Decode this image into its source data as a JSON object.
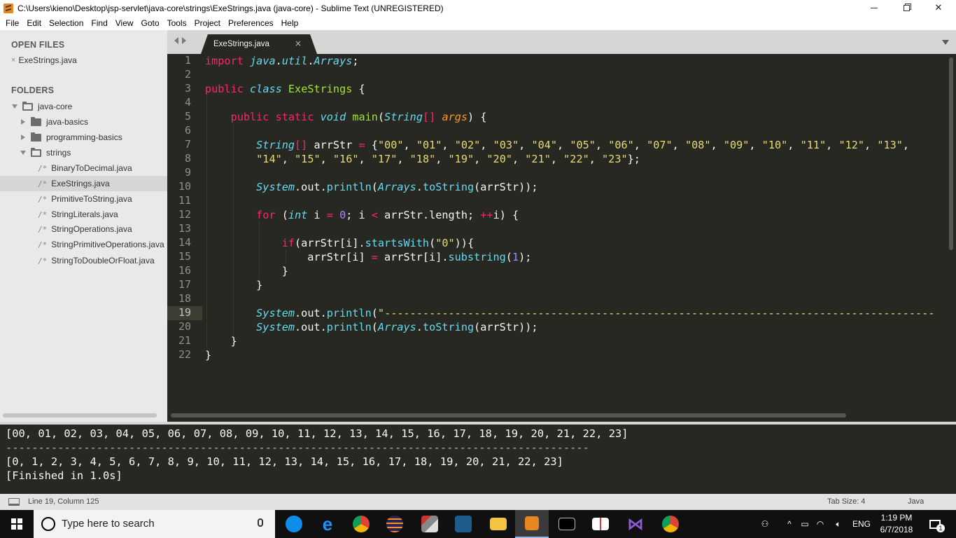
{
  "window": {
    "title": "C:\\Users\\kieno\\Desktop\\jsp-servlet\\java-core\\strings\\ExeStrings.java (java-core) - Sublime Text (UNREGISTERED)",
    "minimize": "–",
    "restore": "❐",
    "close": "✕"
  },
  "menu": [
    "File",
    "Edit",
    "Selection",
    "Find",
    "View",
    "Goto",
    "Tools",
    "Project",
    "Preferences",
    "Help"
  ],
  "sidebar": {
    "open_files_heading": "OPEN FILES",
    "open_files": [
      {
        "name": "ExeStrings.java",
        "close": "×"
      }
    ],
    "folders_heading": "FOLDERS",
    "tree": [
      {
        "label": "java-core",
        "kind": "folder-open"
      },
      {
        "label": "java-basics",
        "kind": "folder"
      },
      {
        "label": "programming-basics",
        "kind": "folder"
      },
      {
        "label": "strings",
        "kind": "folder-open"
      },
      {
        "label": "BinaryToDecimal.java",
        "kind": "file"
      },
      {
        "label": "ExeStrings.java",
        "kind": "file",
        "selected": true
      },
      {
        "label": "PrimitiveToString.java",
        "kind": "file"
      },
      {
        "label": "StringLiterals.java",
        "kind": "file"
      },
      {
        "label": "StringOperations.java",
        "kind": "file"
      },
      {
        "label": "StringPrimitiveOperations.java",
        "kind": "file"
      },
      {
        "label": "StringToDoubleOrFloat.java",
        "kind": "file"
      }
    ],
    "file_glyph": "/*"
  },
  "editor": {
    "tab": {
      "label": "ExeStrings.java",
      "close": "×"
    },
    "current_line": 19,
    "line_numbers": [
      "1",
      "2",
      "3",
      "4",
      "5",
      "6",
      "7",
      "8",
      "9",
      "10",
      "11",
      "12",
      "13",
      "14",
      "15",
      "16",
      "17",
      "18",
      "19",
      "20",
      "21",
      "22"
    ]
  },
  "output": {
    "lines": [
      "[00, 01, 02, 03, 04, 05, 06, 07, 08, 09, 10, 11, 12, 13, 14, 15, 16, 17, 18, 19, 20, 21, 22, 23]",
      "------------------------------------------------------------------------------------------",
      "[0, 1, 2, 3, 4, 5, 6, 7, 8, 9, 10, 11, 12, 13, 14, 15, 16, 17, 18, 19, 20, 21, 22, 23]",
      "[Finished in 1.0s]"
    ]
  },
  "status": {
    "position": "Line 19, Column 125",
    "tab_size": "Tab Size: 4",
    "syntax": "Java"
  },
  "taskbar": {
    "search_placeholder": "Type here to search",
    "language": "ENG",
    "time": "1:19 PM",
    "date": "6/7/2018",
    "notification_count": "1",
    "apps": [
      "teamviewer-icon",
      "edge-icon",
      "chrome-icon",
      "eclipse-icon",
      "tools-icon",
      "visual-studio-code-icon",
      "file-explorer-icon",
      "sublime-text-icon",
      "terminal-icon",
      "snipping-icon",
      "visual-studio-icon",
      "chrome-icon"
    ]
  },
  "colors": {
    "editor_bg": "#272822",
    "keyword": "#f92672",
    "type": "#66d9ef",
    "function": "#a6e22e",
    "string": "#e6db74",
    "number": "#ae81ff",
    "sidebar_bg": "#e9e9e9"
  }
}
